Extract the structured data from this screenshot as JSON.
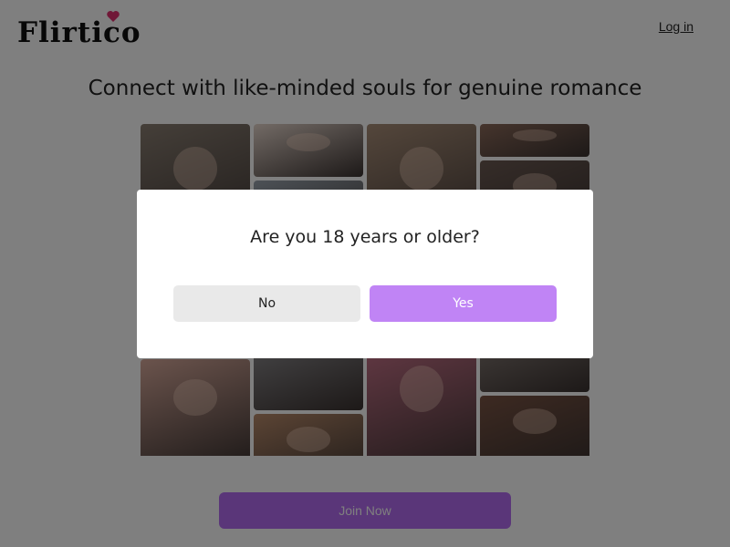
{
  "header": {
    "logo_text": "Flirtico",
    "login_label": "Log in"
  },
  "hero": {
    "tagline": "Connect with like-minded souls for genuine romance"
  },
  "collage": {
    "columns": [
      [
        {
          "color": "#8a7e72"
        },
        {
          "color": "#c9b9a5"
        },
        {
          "color": "#d6a89a"
        }
      ],
      [
        {
          "color": "#e6d6cc"
        },
        {
          "color": "#9aa3ad"
        },
        {
          "color": "#cfd3da"
        },
        {
          "color": "#b88a6a"
        }
      ],
      [
        {
          "color": "#a98e78"
        },
        {
          "color": "#c7a9a0"
        },
        {
          "color": "#c9738a"
        }
      ],
      [
        {
          "color": "#8c6a5a"
        },
        {
          "color": "#6c5a52"
        },
        {
          "color": "#d3c6bd"
        },
        {
          "color": "#7a5444"
        }
      ]
    ]
  },
  "cta": {
    "join_label": "Join Now"
  },
  "modal": {
    "question": "Are you 18 years or older?",
    "no_label": "No",
    "yes_label": "Yes"
  },
  "colors": {
    "accent": "#c084f5",
    "join": "#b46cf2",
    "overlay": "rgba(0,0,0,0.5)"
  }
}
